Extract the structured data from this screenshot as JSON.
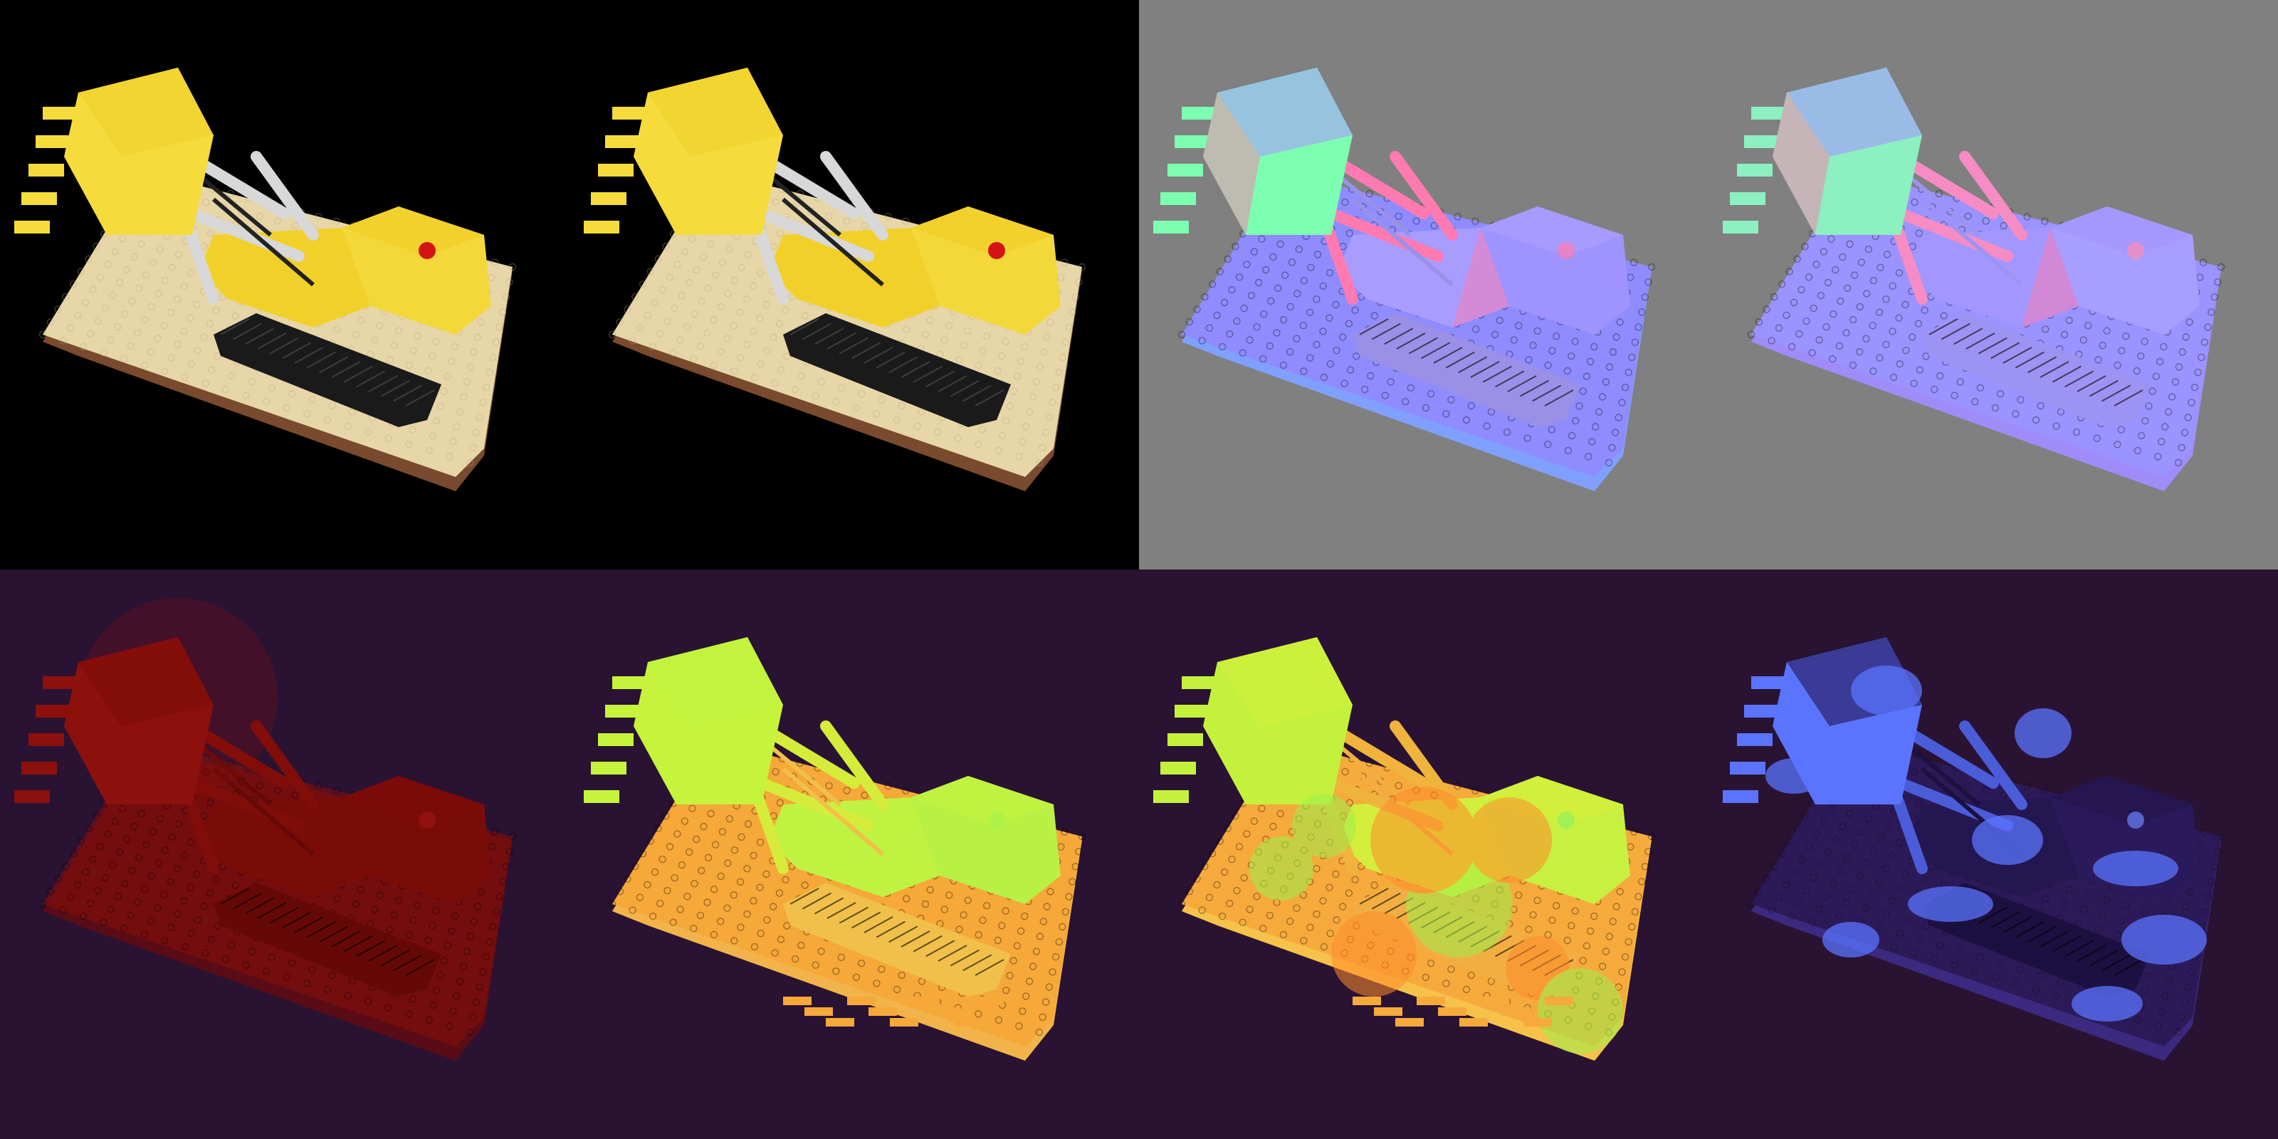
{
  "layout": {
    "columns": 4,
    "rows": 2
  },
  "panels": [
    {
      "name": "rgb-render-ground-truth",
      "style": "rgb",
      "background": "#000000"
    },
    {
      "name": "rgb-render-predicted",
      "style": "rgb",
      "background": "#000000"
    },
    {
      "name": "normal-map-ground-truth",
      "style": "normal-gt",
      "background": "#808080"
    },
    {
      "name": "normal-map-predicted",
      "style": "normal-pred",
      "background": "#808080"
    },
    {
      "name": "error-map",
      "style": "error",
      "background": "#2a1233"
    },
    {
      "name": "depth-map-ground-truth",
      "style": "depth-gt",
      "background": "#2a1233"
    },
    {
      "name": "depth-map-predicted",
      "style": "depth-pred",
      "background": "#2a1233"
    },
    {
      "name": "uncertainty-map",
      "style": "uncertainty",
      "background": "#2a1233"
    }
  ],
  "colors": {
    "lego_yellow": "#f2d02a",
    "lego_tan": "#e6d6a8",
    "lego_brown": "#7a4a2e",
    "lego_black": "#1a1a1a",
    "lego_red": "#d41414",
    "normal_blue": "#8f8cff",
    "normal_pink": "#ff7ab0",
    "normal_green": "#7cffb0",
    "error_red": "#8a0e0a",
    "depth_green": "#bff241",
    "depth_orange": "#f6a838",
    "uncertainty_blue": "#5a74ff"
  }
}
